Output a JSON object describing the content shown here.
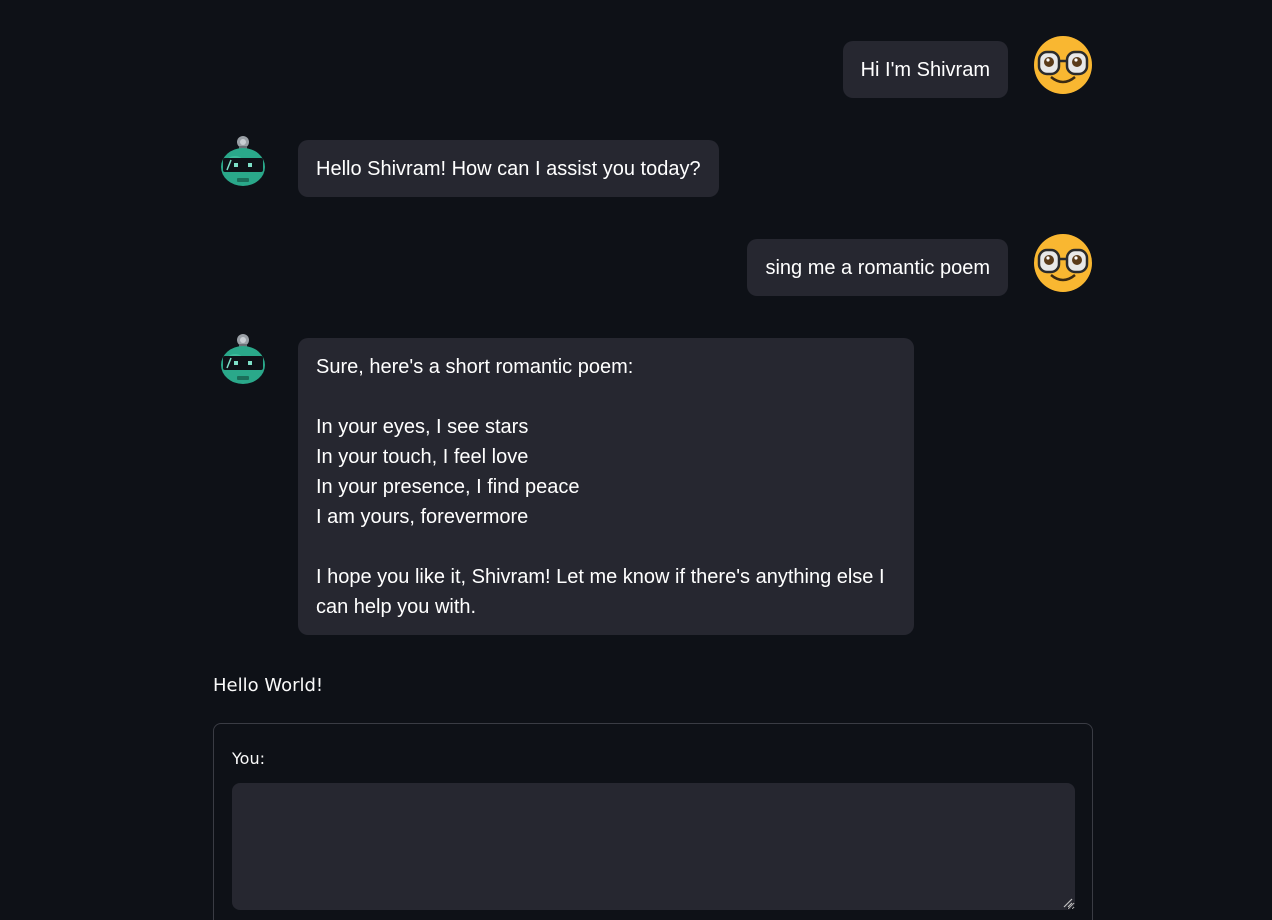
{
  "messages": [
    {
      "role": "user",
      "avatar": "nerd-face-emoji",
      "text": "Hi I'm Shivram"
    },
    {
      "role": "assistant",
      "avatar": "robot-avatar",
      "text": "Hello Shivram! How can I assist you today?"
    },
    {
      "role": "user",
      "avatar": "nerd-face-emoji",
      "text": "sing me a romantic poem"
    },
    {
      "role": "assistant",
      "avatar": "robot-avatar",
      "text": "Sure, here's a short romantic poem:\n\nIn your eyes, I see stars\nIn your touch, I feel love\nIn your presence, I find peace\nI am yours, forevermore\n\nI hope you like it, Shivram! Let me know if there's anything else I can help you with."
    }
  ],
  "caption": "Hello World!",
  "input_form": {
    "label": "You:",
    "value": ""
  },
  "colors": {
    "background": "#0e1117",
    "bubble": "#262730",
    "user_avatar": "#f9b731",
    "bot_avatar": "#2aa88a"
  }
}
